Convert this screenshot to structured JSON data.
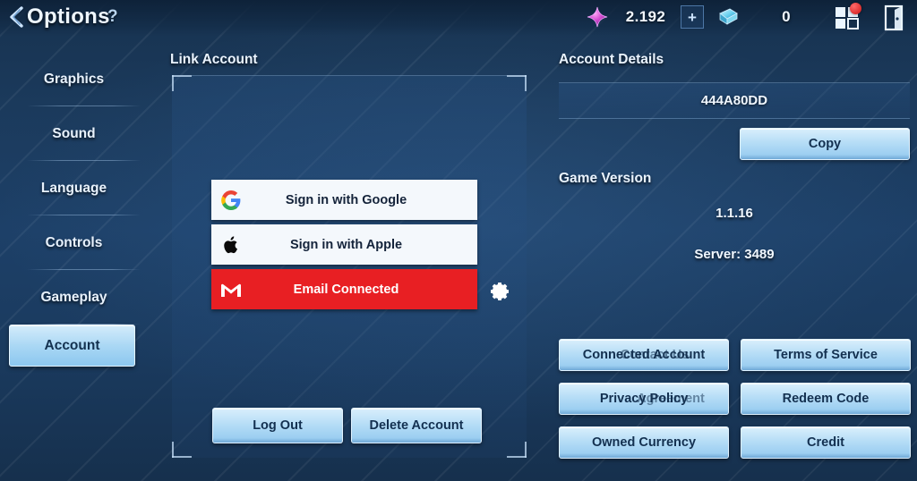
{
  "header": {
    "title": "Options",
    "help_label": "?",
    "back_icon": "back-chevron-icon"
  },
  "topbar": {
    "gem": {
      "icon": "gem-icon",
      "value": "2.192",
      "add_label": "+"
    },
    "cash": {
      "icon": "cash-card-icon",
      "value": "0"
    },
    "grid_icon": "grid-menu-icon",
    "exit_icon": "exit-door-icon",
    "badge": ""
  },
  "sidebar": {
    "items": [
      {
        "label": "Graphics",
        "active": false
      },
      {
        "label": "Sound",
        "active": false
      },
      {
        "label": "Language",
        "active": false
      },
      {
        "label": "Controls",
        "active": false
      },
      {
        "label": "Gameplay",
        "active": false
      },
      {
        "label": "Account",
        "active": true
      }
    ]
  },
  "link_account": {
    "heading": "Link Account",
    "buttons": [
      {
        "label": "Sign in with Google",
        "icon": "google-g-icon",
        "style": "white"
      },
      {
        "label": "Sign in with Apple",
        "icon": "apple-logo-icon",
        "style": "white"
      },
      {
        "label": "Email Connected",
        "icon": "gmail-m-icon",
        "style": "red"
      }
    ],
    "settings_icon": "gear-icon",
    "log_out_label": "Log Out",
    "delete_account_label": "Delete Account"
  },
  "account_details": {
    "heading": "Account Details",
    "account_id": "444A80DD",
    "copy_label": "Copy"
  },
  "game_version": {
    "heading": "Game Version",
    "version": "1.1.16",
    "server": "Server: 3489"
  },
  "links": {
    "contact_label": "Connected Account",
    "contact_ghost": "Contact Us",
    "terms_label": "Terms of Service",
    "privacy_label": "Privacy Policy",
    "privacy_ghost": "Agreement",
    "redeem_label": "Redeem Code",
    "owned_currency_label": "Owned Currency",
    "credit_label": "Credit"
  },
  "colors": {
    "accent_blue": "#b4dcf6",
    "panel_navy": "#1d4068",
    "email_red": "#e81f23",
    "gem_pink": "#d44bd0",
    "cash_cyan": "#7fd8f0",
    "badge_red": "#cc1414"
  }
}
